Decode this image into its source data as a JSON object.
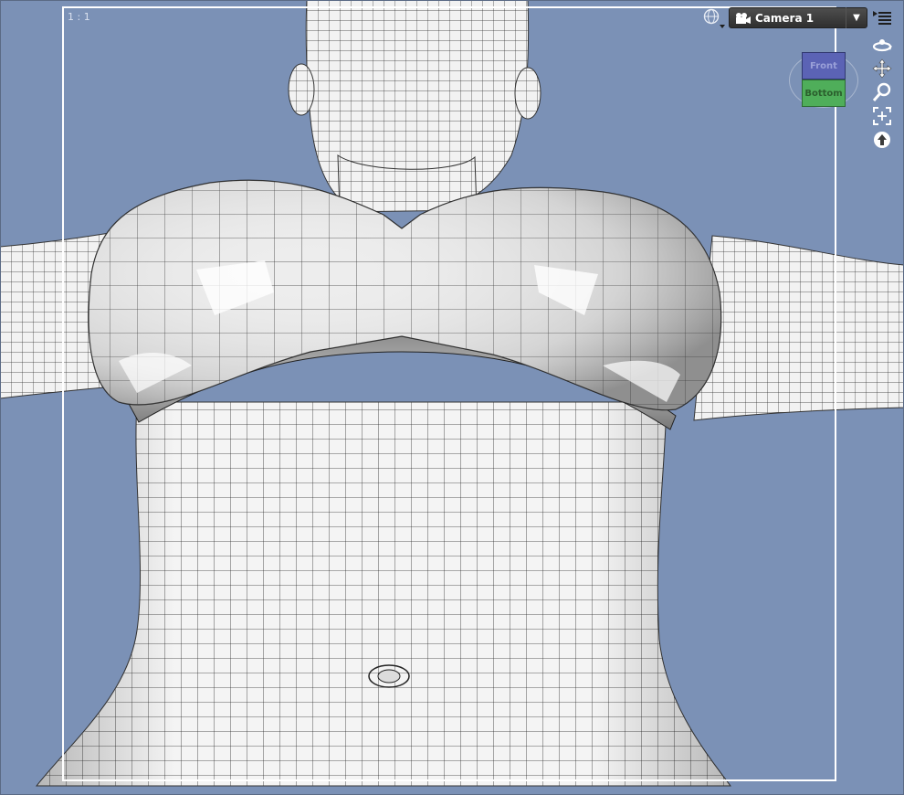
{
  "viewport": {
    "aspect_label": "1 : 1",
    "background_color": "#7b91b6"
  },
  "camera_selector": {
    "icon": "camera-icon",
    "label": "Camera 1",
    "dropdown_icon": "chevron-down-icon"
  },
  "view_cube": {
    "front_label": "Front",
    "bottom_label": "Bottom"
  },
  "toolbar": {
    "globe_icon": "globe-icon",
    "menu_icon": "viewport-menu-icon",
    "nav_tools": [
      "orbit-icon",
      "pan-icon",
      "zoom-icon",
      "frame-icon",
      "reset-icon"
    ]
  }
}
